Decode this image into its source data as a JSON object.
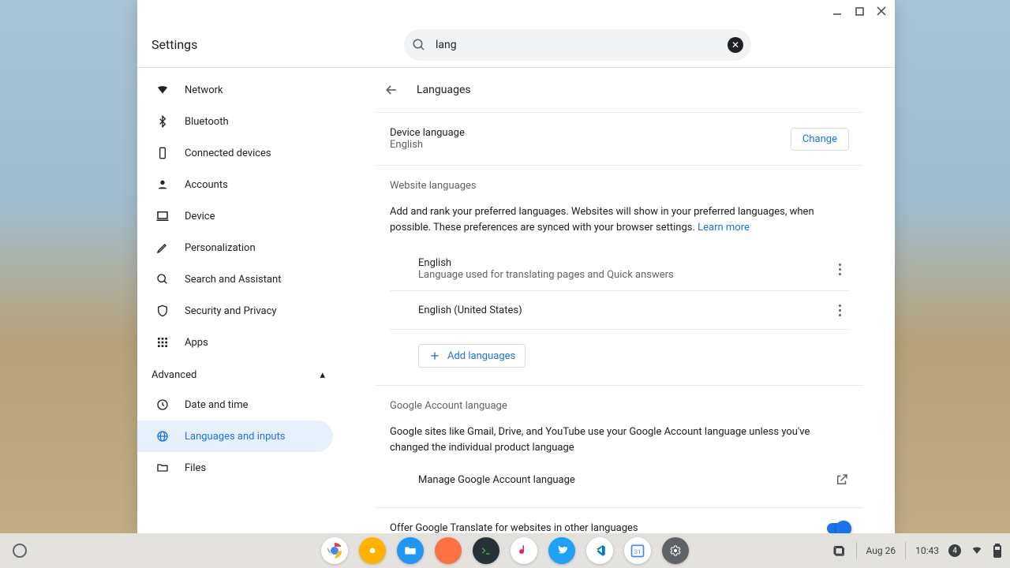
{
  "window": {
    "title": "Settings",
    "search_value": "lang"
  },
  "sidebar": {
    "items": [
      {
        "label": "Network"
      },
      {
        "label": "Bluetooth"
      },
      {
        "label": "Connected devices"
      },
      {
        "label": "Accounts"
      },
      {
        "label": "Device"
      },
      {
        "label": "Personalization"
      },
      {
        "label": "Search and Assistant"
      },
      {
        "label": "Security and Privacy"
      },
      {
        "label": "Apps"
      }
    ],
    "advanced_label": "Advanced",
    "advanced_items": [
      {
        "label": "Date and time"
      },
      {
        "label": "Languages and inputs"
      },
      {
        "label": "Files"
      }
    ]
  },
  "page": {
    "title": "Languages",
    "device_lang_title": "Device language",
    "device_lang_value": "English",
    "change_btn": "Change",
    "website_title": "Website languages",
    "website_desc": "Add and rank your preferred languages. Websites will show in your preferred languages, when possible. These preferences are synced with your browser settings. ",
    "learn_more": "Learn more",
    "langs": [
      {
        "name": "English",
        "sub": "Language used for translating pages and Quick answers"
      },
      {
        "name": "English (United States)",
        "sub": ""
      }
    ],
    "add_languages": "Add languages",
    "google_title": "Google Account language",
    "google_desc": "Google sites like Gmail, Drive, and YouTube use your Google Account language unless you've changed the individual product language",
    "manage_google": "Manage Google Account language",
    "translate_offer": "Offer Google Translate for websites in other languages"
  },
  "taskbar": {
    "date": "Aug 26",
    "time": "10:43",
    "notif": "4"
  }
}
